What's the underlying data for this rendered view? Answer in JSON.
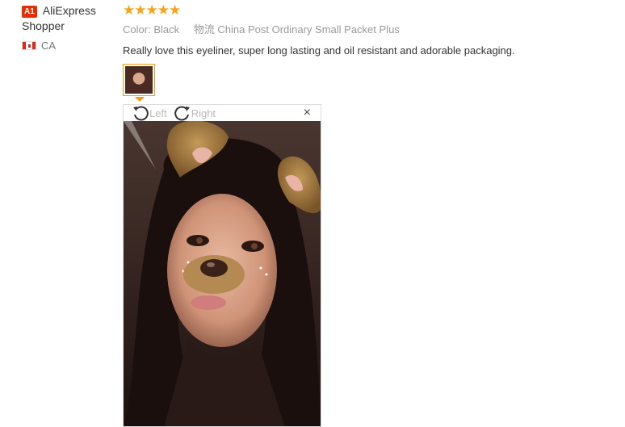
{
  "user": {
    "badge": "A1",
    "name_line1": "AliExpress",
    "name_line2": "Shopper",
    "country": "CA"
  },
  "review": {
    "rating": 5,
    "stars": "★★★★★",
    "color_label": "Color:",
    "color_value": "Black",
    "shipping_label": "物流",
    "shipping_value": "China Post Ordinary Small Packet Plus",
    "comment": "Really love this eyeliner, super long lasting and oil resistant and adorable packaging."
  },
  "viewer": {
    "rotate_left_label": "Left",
    "rotate_right_label": "Right",
    "close_glyph": "×"
  },
  "colors": {
    "badge": "#e62e04",
    "stars": "#f7a41c",
    "thumb_border": "#ff9900"
  }
}
